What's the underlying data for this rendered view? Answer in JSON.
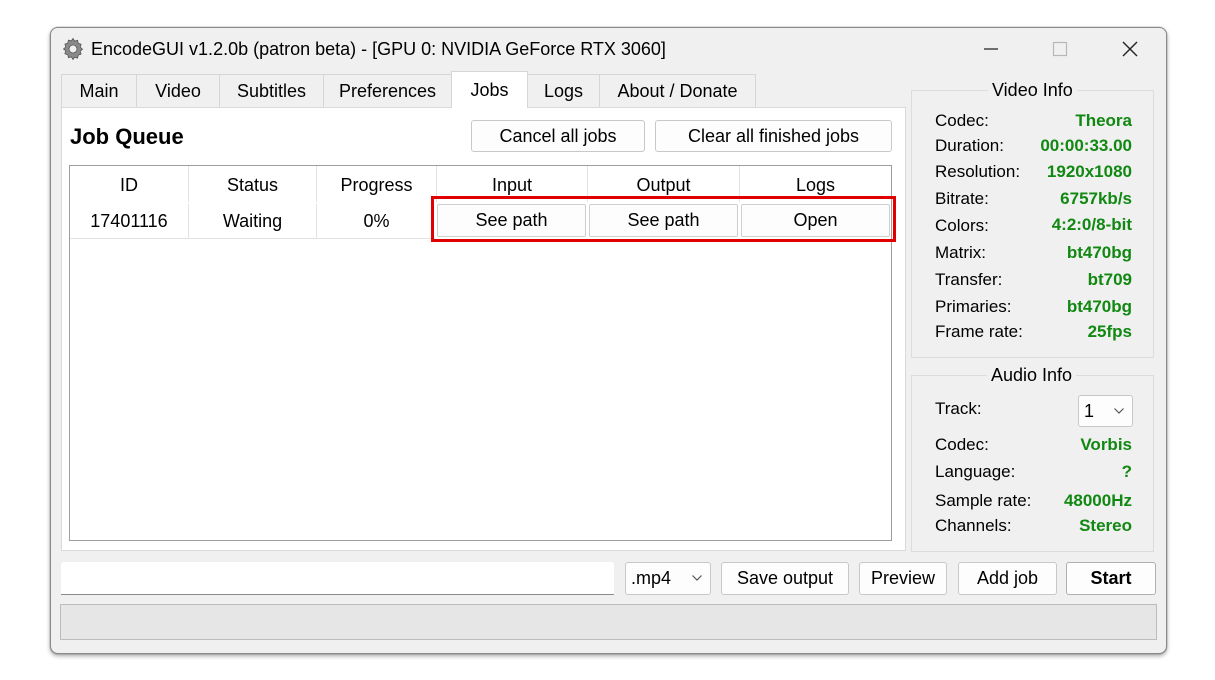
{
  "window": {
    "title": "EncodeGUI v1.2.0b (patron beta) - [GPU 0: NVIDIA GeForce RTX 3060]",
    "icons": {
      "app": "gear-icon",
      "minimize": "minimize-icon",
      "maximize": "maximize-icon",
      "close": "close-icon"
    }
  },
  "tabs": [
    {
      "label": "Main"
    },
    {
      "label": "Video"
    },
    {
      "label": "Subtitles"
    },
    {
      "label": "Preferences"
    },
    {
      "label": "Jobs",
      "active": true
    },
    {
      "label": "Logs"
    },
    {
      "label": "About / Donate"
    }
  ],
  "jobs": {
    "title": "Job Queue",
    "cancel_all_label": "Cancel all jobs",
    "clear_finished_label": "Clear all finished jobs",
    "columns": [
      "ID",
      "Status",
      "Progress",
      "Input",
      "Output",
      "Logs"
    ],
    "rows": [
      {
        "id": "17401116",
        "status": "Waiting",
        "progress": "0%",
        "input": "See path",
        "output": "See path",
        "logs": "Open"
      }
    ],
    "highlight_color": "#e00000"
  },
  "video_info": {
    "title": "Video Info",
    "value_color": "#118811",
    "fields": [
      {
        "label": "Codec:",
        "value": "Theora"
      },
      {
        "label": "Duration:",
        "value": "00:00:33.00"
      },
      {
        "label": "Resolution:",
        "value": "1920x1080"
      },
      {
        "label": "Bitrate:",
        "value": "6757kb/s"
      },
      {
        "label": "Colors:",
        "value": "4:2:0/8-bit"
      },
      {
        "label": "Matrix:",
        "value": "bt470bg"
      },
      {
        "label": "Transfer:",
        "value": "bt709"
      },
      {
        "label": "Primaries:",
        "value": "bt470bg"
      },
      {
        "label": "Frame rate:",
        "value": "25fps"
      }
    ]
  },
  "audio_info": {
    "title": "Audio Info",
    "track_label": "Track:",
    "track_value": "1",
    "fields": [
      {
        "label": "Codec:",
        "value": "Vorbis"
      },
      {
        "label": "Language:",
        "value": "?"
      },
      {
        "label": "Sample rate:",
        "value": "48000Hz"
      },
      {
        "label": "Channels:",
        "value": "Stereo"
      }
    ]
  },
  "bottom": {
    "output_path_value": "",
    "container_value": ".mp4",
    "save_output_label": "Save output",
    "preview_label": "Preview",
    "add_job_label": "Add job",
    "start_label": "Start",
    "progress_fraction": 0
  }
}
